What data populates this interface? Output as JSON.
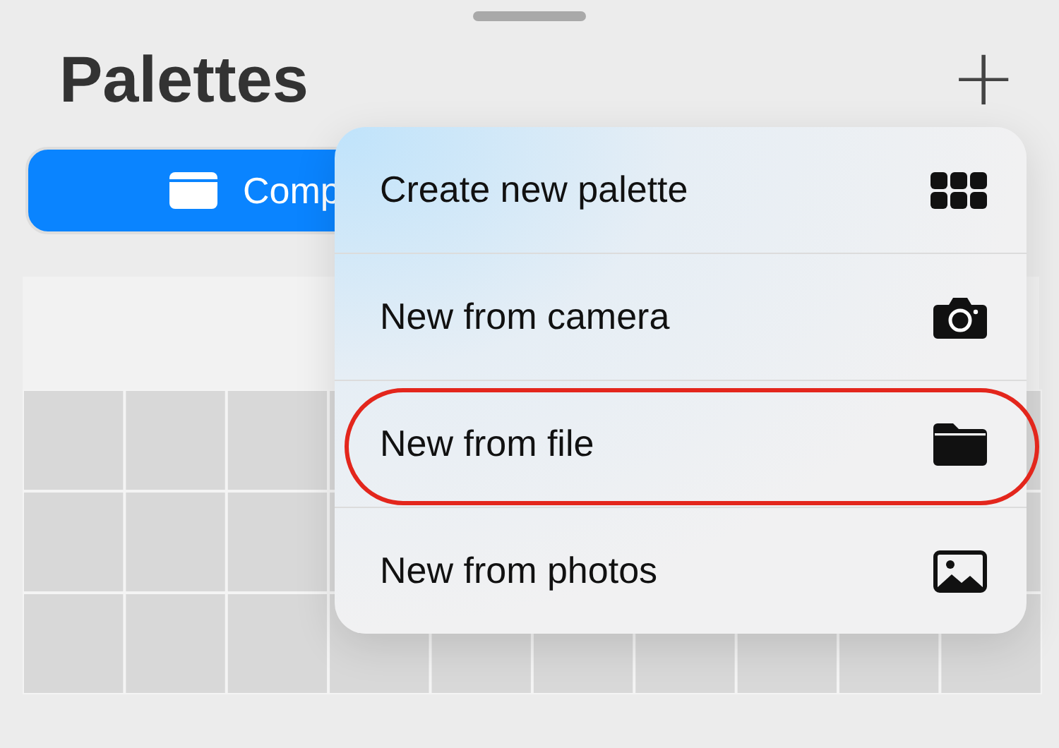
{
  "title": "Palettes",
  "add_button": {
    "label": "+"
  },
  "view_toggle": {
    "label": "Comp",
    "selected": true
  },
  "menu": {
    "items": [
      {
        "label": "Create new palette",
        "kind": "grid",
        "circled": false
      },
      {
        "label": "New from camera",
        "kind": "camera",
        "circled": false
      },
      {
        "label": "New from file",
        "kind": "folder",
        "circled": true
      },
      {
        "label": "New from photos",
        "kind": "photo",
        "circled": false
      }
    ]
  }
}
